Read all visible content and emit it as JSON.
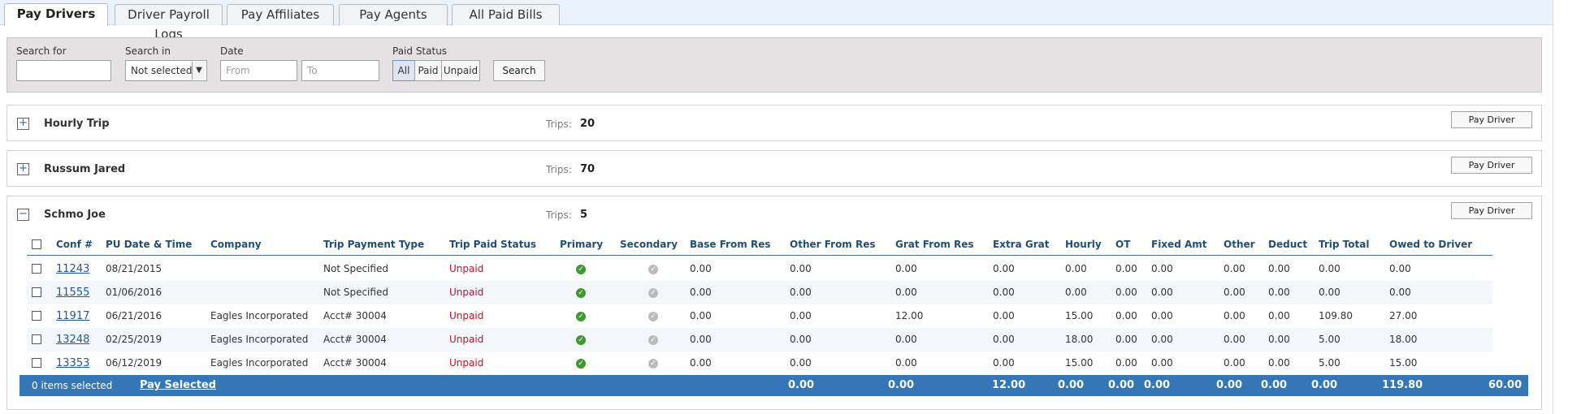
{
  "tabs": [
    {
      "label": "Pay Drivers",
      "active": true
    },
    {
      "label": "Driver Payroll Logs",
      "active": false
    },
    {
      "label": "Pay Affiliates",
      "active": false
    },
    {
      "label": "Pay Agents",
      "active": false
    },
    {
      "label": "All Paid Bills",
      "active": false
    }
  ],
  "search": {
    "search_for_label": "Search for",
    "search_for_value": "",
    "search_in_label": "Search in",
    "search_in_value": "Not selected",
    "date_label": "Date",
    "date_from_placeholder": "From",
    "date_to_placeholder": "To",
    "paid_status_label": "Paid Status",
    "paid_status_options": [
      "All",
      "Paid",
      "Unpaid"
    ],
    "paid_status_selected": "All",
    "search_button": "Search"
  },
  "groups": [
    {
      "name": "Hourly Trip",
      "trips_label": "Trips:",
      "trips": "20",
      "expanded": false,
      "expand_symbol": "+",
      "pay_button": "Pay Driver"
    },
    {
      "name": "Russum Jared",
      "trips_label": "Trips:",
      "trips": "70",
      "expanded": false,
      "expand_symbol": "+",
      "pay_button": "Pay Driver"
    },
    {
      "name": "Schmo Joe",
      "trips_label": "Trips:",
      "trips": "5",
      "expanded": true,
      "expand_symbol": "−",
      "pay_button": "Pay Driver"
    }
  ],
  "table": {
    "columns": [
      "Conf #",
      "PU Date & Time",
      "Company",
      "Trip Payment Type",
      "Trip Paid Status",
      "Primary",
      "Secondary",
      "Base From Res",
      "Other From Res",
      "Grat From Res",
      "Extra Grat",
      "Hourly",
      "OT",
      "Fixed Amt",
      "Other",
      "Deduct",
      "Trip Total",
      "Owed to Driver"
    ],
    "rows": [
      {
        "conf": "11243",
        "date": "08/21/2015",
        "company": "",
        "payment_type": "Not Specified",
        "paid_status": "Unpaid",
        "base": "0.00",
        "other_res": "0.00",
        "grat": "0.00",
        "extra_grat": "0.00",
        "hourly": "0.00",
        "ot": "0.00",
        "fixed": "0.00",
        "other": "0.00",
        "deduct": "0.00",
        "trip_total": "0.00",
        "owed": "0.00"
      },
      {
        "conf": "11555",
        "date": "01/06/2016",
        "company": "",
        "payment_type": "Not Specified",
        "paid_status": "Unpaid",
        "base": "0.00",
        "other_res": "0.00",
        "grat": "0.00",
        "extra_grat": "0.00",
        "hourly": "0.00",
        "ot": "0.00",
        "fixed": "0.00",
        "other": "0.00",
        "deduct": "0.00",
        "trip_total": "0.00",
        "owed": "0.00"
      },
      {
        "conf": "11917",
        "date": "06/21/2016",
        "company": "Eagles Incorporated",
        "payment_type": "Acct# 30004",
        "paid_status": "Unpaid",
        "base": "0.00",
        "other_res": "0.00",
        "grat": "12.00",
        "extra_grat": "0.00",
        "hourly": "15.00",
        "ot": "0.00",
        "fixed": "0.00",
        "other": "0.00",
        "deduct": "0.00",
        "trip_total": "109.80",
        "owed": "27.00"
      },
      {
        "conf": "13248",
        "date": "02/25/2019",
        "company": "Eagles Incorporated",
        "payment_type": "Acct# 30004",
        "paid_status": "Unpaid",
        "base": "0.00",
        "other_res": "0.00",
        "grat": "0.00",
        "extra_grat": "0.00",
        "hourly": "18.00",
        "ot": "0.00",
        "fixed": "0.00",
        "other": "0.00",
        "deduct": "0.00",
        "trip_total": "5.00",
        "owed": "18.00"
      },
      {
        "conf": "13353",
        "date": "06/12/2019",
        "company": "Eagles Incorporated",
        "payment_type": "Acct# 30004",
        "paid_status": "Unpaid",
        "base": "0.00",
        "other_res": "0.00",
        "grat": "0.00",
        "extra_grat": "0.00",
        "hourly": "15.00",
        "ot": "0.00",
        "fixed": "0.00",
        "other": "0.00",
        "deduct": "0.00",
        "trip_total": "5.00",
        "owed": "15.00"
      }
    ],
    "footer": {
      "selected_text": "0 items selected",
      "pay_selected": "Pay Selected",
      "base": "0.00",
      "other_res": "0.00",
      "grat": "12.00",
      "extra_grat": "0.00",
      "hourly": "0.00",
      "ot": "0.00",
      "fixed": "0.00",
      "other": "0.00",
      "deduct": "0.00",
      "trip_total": "119.80",
      "owed": "60.00"
    }
  },
  "colors": {
    "accent": "#3377b6",
    "link": "#1f57a8",
    "unpaid": "#c0122b",
    "header_text": "#1f4e79",
    "primary_ok": "#3d9b2b",
    "secondary_ok": "#bcbcbc"
  }
}
